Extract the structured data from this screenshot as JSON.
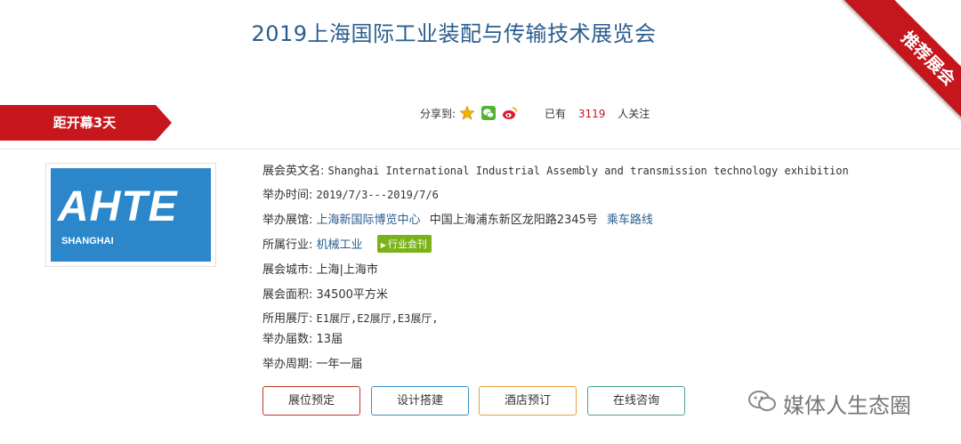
{
  "header": {
    "title": "2019上海国际工业装配与传输技术展览会",
    "ribbon_label": "推荐展会"
  },
  "countdown": {
    "label": "距开幕3天"
  },
  "share": {
    "label": "分享到:",
    "icons": [
      "star-icon",
      "wechat-icon",
      "weibo-icon"
    ],
    "followers_prefix": "已有",
    "followers_count": "3119",
    "followers_suffix": "人关注"
  },
  "logo": {
    "main_text": "AHTE",
    "sub_text": "SHANGHAI"
  },
  "details": {
    "english_name_label": "展会英文名:",
    "english_name": "Shanghai International Industrial Assembly and transmission technology exhibition",
    "time_label": "举办时间:",
    "time_value": "2019/7/3---2019/7/6",
    "venue_label": "举办展馆:",
    "venue_link": "上海新国际博览中心",
    "venue_address": "中国上海浦东新区龙阳路2345号",
    "venue_route": "乘车路线",
    "industry_label": "所属行业:",
    "industry_link": "机械工业",
    "industry_badge": "行业会刊",
    "city_label": "展会城市:",
    "city_value": "上海|上海市",
    "area_label": "展会面积:",
    "area_value": "34500平方米",
    "halls_label": "所用展厅:",
    "halls_value": "E1展厅,E2展厅,E3展厅,",
    "sessions_label": "举办届数:",
    "sessions_value": "13届",
    "cycle_label": "举办周期:",
    "cycle_value": "一年一届"
  },
  "actions": {
    "booth_label": "展位预定",
    "design_label": "设计搭建",
    "hotel_label": "酒店预订",
    "consult_label": "在线咨询"
  },
  "watermark": {
    "text": "媒体人生态圈"
  },
  "colors": {
    "brand_red": "#c8161d",
    "title_blue": "#2a5d8f",
    "logo_blue": "#2b87c9",
    "badge_green": "#7ab317",
    "btn_red": "#c0392b",
    "btn_blue": "#3a8fc7",
    "btn_orange": "#e6a23c",
    "btn_green": "#4aa394"
  }
}
